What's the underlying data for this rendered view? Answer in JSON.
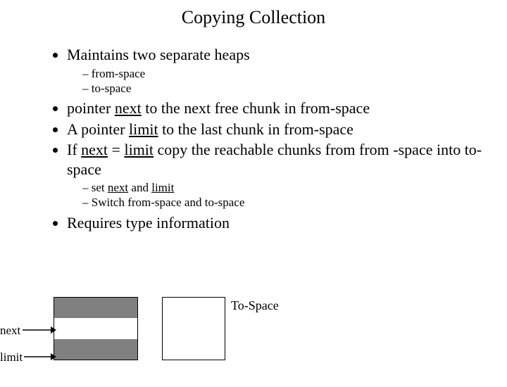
{
  "title": "Copying Collection",
  "b1": "Maintains two separate heaps",
  "b1s1": "from-space",
  "b1s2": "to-space",
  "b2_pre": "pointer ",
  "b2_u": "next",
  "b2_post": " to the next free chunk in from-space",
  "b3_pre": "A pointer ",
  "b3_u": "limit",
  "b3_post": " to the last chunk in from-space",
  "b4_pre": "If ",
  "b4_u1": "next",
  "b4_mid": " = ",
  "b4_u2": "limit",
  "b4_post": " copy the reachable chunks from from -space into to-space",
  "b4s1_pre": "set ",
  "b4s1_u1": "next",
  "b4s1_mid": " and ",
  "b4s1_u2": "limit",
  "b4s2": "Switch from-space and to-space",
  "b5": "Requires type information",
  "to_space": "To-Space",
  "next_label": "next",
  "limit_label": "limit"
}
